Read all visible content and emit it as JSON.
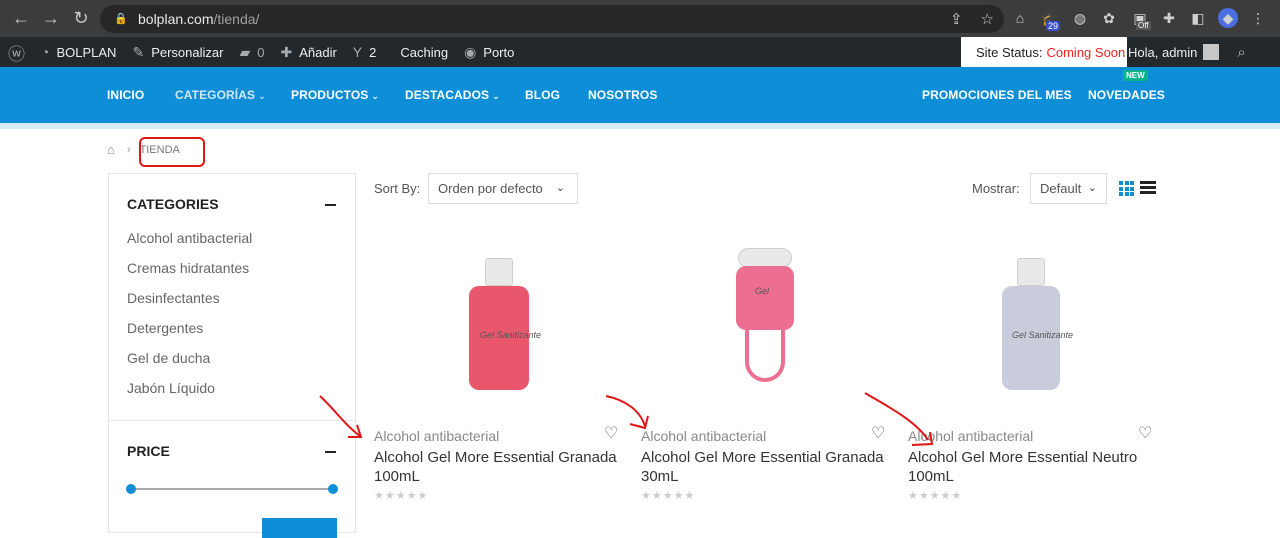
{
  "browser": {
    "url_host": "bolplan.com",
    "url_path": "/tienda/",
    "ext_badge": "29",
    "ext_off": "Off"
  },
  "wpbar": {
    "site": "BOLPLAN",
    "customize": "Personalizar",
    "comments": "0",
    "add": "Añadir",
    "yoast": "2",
    "caching": "Caching",
    "theme": "Porto",
    "status_label": "Site Status:",
    "status_value": "Coming Soon",
    "greeting": "Hola, admin"
  },
  "nav": {
    "items": [
      "INICIO",
      "CATEGORÍAS",
      "PRODUCTOS",
      "DESTACADOS",
      "BLOG",
      "NOSOTROS"
    ],
    "promo": "PROMOCIONES DEL MES",
    "novedades": "NOVEDADES",
    "new_tag": "NEW"
  },
  "breadcrumb": {
    "current": "TIENDA"
  },
  "sidebar": {
    "categories_title": "CATEGORIES",
    "categories": [
      "Alcohol antibacterial",
      "Cremas hidratantes",
      "Desinfectantes",
      "Detergentes",
      "Gel de ducha",
      "Jabón Líquido"
    ],
    "price_title": "PRICE",
    "price_range": [
      0,
      1
    ]
  },
  "toolbar": {
    "sort_label": "Sort By:",
    "sort_value": "Orden por defecto",
    "show_label": "Mostrar:",
    "show_value": "Default"
  },
  "products": [
    {
      "category": "Alcohol antibacterial",
      "title": "Alcohol Gel More Essential Granada 100mL",
      "rating": 0,
      "color": "#e9576d",
      "bottle_text": "Gel Sanitizante"
    },
    {
      "category": "Alcohol antibacterial",
      "title": "Alcohol Gel More Essential Granada 30mL",
      "rating": 0,
      "color": "#ec6f91",
      "bottle_text": "Gel"
    },
    {
      "category": "Alcohol antibacterial",
      "title": "Alcohol Gel More Essential Neutro 100mL",
      "rating": 0,
      "color": "#c9ccdb",
      "bottle_text": "Gel Sanitizante"
    }
  ],
  "colors": {
    "accent": "#0e8ed6",
    "annotation": "#e01515"
  }
}
